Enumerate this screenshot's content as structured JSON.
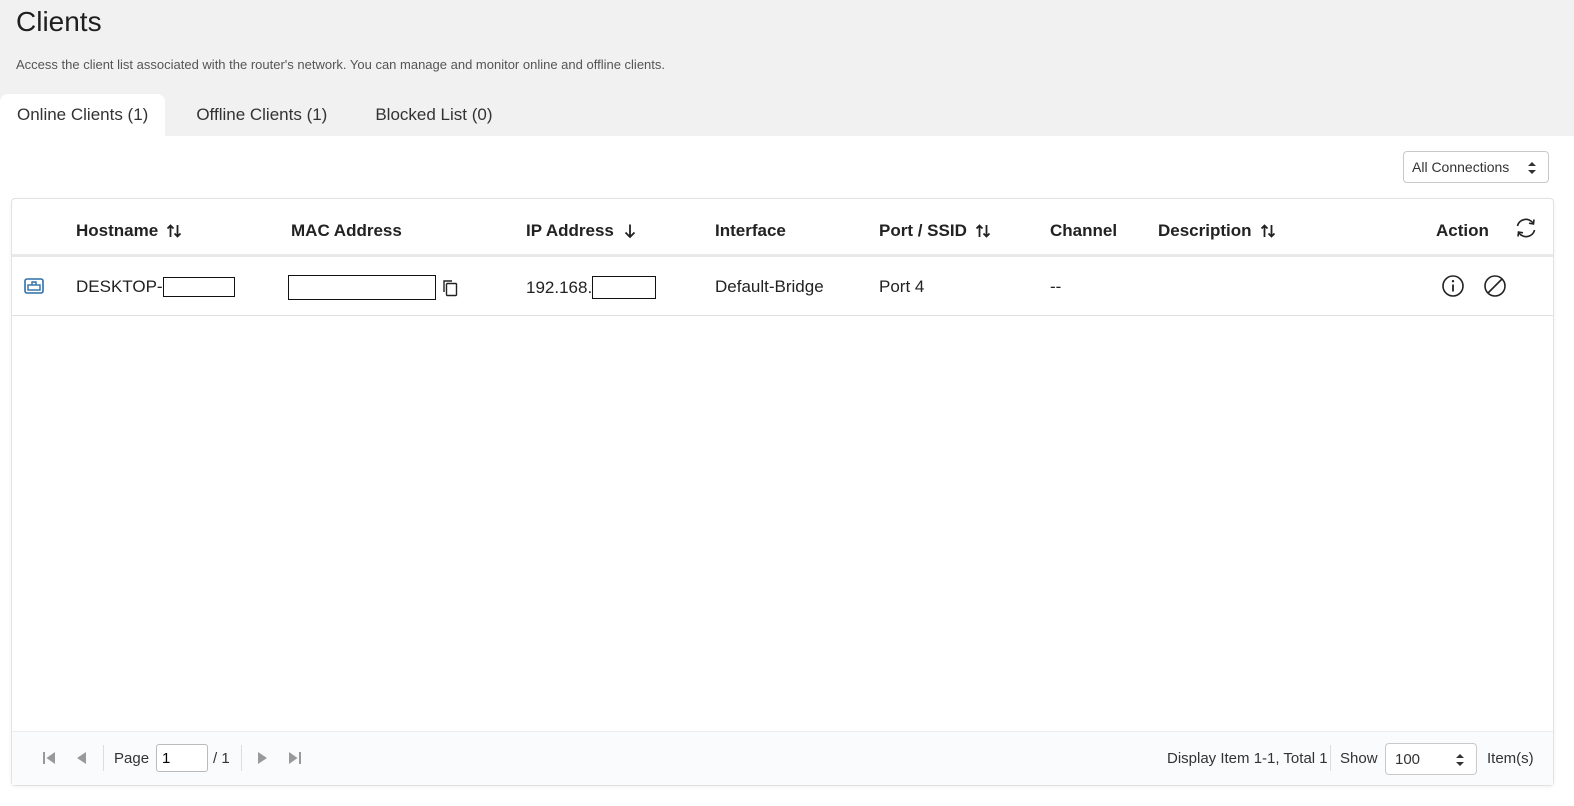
{
  "page": {
    "title": "Clients",
    "description": "Access the client list associated with the router's network. You can manage and monitor online and offline clients."
  },
  "tabs": [
    {
      "label": "Online Clients (1)",
      "active": true
    },
    {
      "label": "Offline Clients (1)",
      "active": false
    },
    {
      "label": "Blocked List (0)",
      "active": false
    }
  ],
  "filter": {
    "connection": "All Connections"
  },
  "table": {
    "columns": {
      "hostname": "Hostname",
      "mac": "MAC Address",
      "ip": "IP Address",
      "interface": "Interface",
      "port": "Port / SSID",
      "channel": "Channel",
      "description": "Description",
      "action": "Action"
    },
    "rows": [
      {
        "hostname": "DESKTOP-",
        "mac": "",
        "ip": "192.168.",
        "interface": "Default-Bridge",
        "port": "Port 4",
        "channel": "--",
        "description": ""
      }
    ]
  },
  "footer": {
    "page_label": "Page",
    "page_value": "1",
    "page_total": "/ 1",
    "display_text": "Display Item 1-1, Total 1",
    "show_label": "Show",
    "show_value": "100",
    "items_label": "Item(s)"
  },
  "colors": {
    "background": "#f1f1f1",
    "panel": "#ffffff",
    "icon_blue": "#2f6fa8",
    "text": "#222222"
  }
}
